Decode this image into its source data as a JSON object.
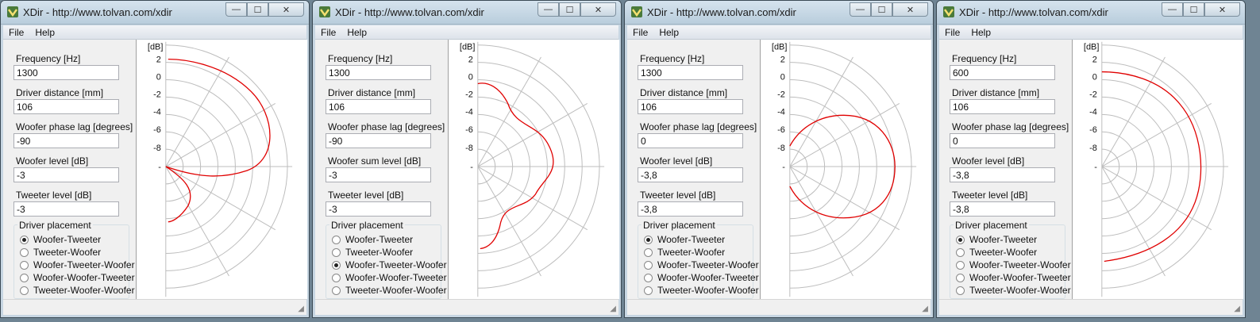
{
  "windows": [
    {
      "title": "XDir - http://www.tolvan.com/xdir",
      "menu": [
        "File",
        "Help"
      ],
      "fields": [
        {
          "label": "Frequency [Hz]",
          "value": "1300"
        },
        {
          "label": "Driver distance [mm]",
          "value": "106"
        },
        {
          "label": "Woofer phase lag [degrees]",
          "value": "-90"
        },
        {
          "label": "Woofer level [dB]",
          "value": "-3"
        },
        {
          "label": "Tweeter level [dB]",
          "value": "-3"
        }
      ],
      "placement_title": "Driver placement",
      "placements": [
        "Woofer-Tweeter",
        "Tweeter-Woofer",
        "Woofer-Tweeter-Woofer",
        "Woofer-Woofer-Tweeter",
        "Tweeter-Woofer-Woofer"
      ],
      "selected_placement": 0,
      "plot": {
        "unit": "[dB]",
        "ticks": [
          "2",
          "0",
          "-2",
          "-4",
          "-6",
          "-8",
          "-"
        ],
        "curve_color": "#e00000"
      }
    },
    {
      "title": "XDir - http://www.tolvan.com/xdir",
      "menu": [
        "File",
        "Help"
      ],
      "fields": [
        {
          "label": "Frequency [Hz]",
          "value": "1300"
        },
        {
          "label": "Driver distance [mm]",
          "value": "106"
        },
        {
          "label": "Woofer phase lag [degrees]",
          "value": "-90"
        },
        {
          "label": "Woofer sum level [dB]",
          "value": "-3"
        },
        {
          "label": "Tweeter level [dB]",
          "value": "-3"
        }
      ],
      "placement_title": "Driver placement",
      "placements": [
        "Woofer-Tweeter",
        "Tweeter-Woofer",
        "Woofer-Tweeter-Woofer",
        "Woofer-Woofer-Tweeter",
        "Tweeter-Woofer-Woofer"
      ],
      "selected_placement": 2,
      "plot": {
        "unit": "[dB]",
        "ticks": [
          "2",
          "0",
          "-2",
          "-4",
          "-6",
          "-8",
          "-"
        ],
        "curve_color": "#e00000"
      }
    },
    {
      "title": "XDir - http://www.tolvan.com/xdir",
      "menu": [
        "File",
        "Help"
      ],
      "fields": [
        {
          "label": "Frequency [Hz]",
          "value": "1300"
        },
        {
          "label": "Driver distance [mm]",
          "value": "106"
        },
        {
          "label": "Woofer phase lag [degrees]",
          "value": "0"
        },
        {
          "label": "Woofer level [dB]",
          "value": "-3,8"
        },
        {
          "label": "Tweeter level [dB]",
          "value": "-3,8"
        }
      ],
      "placement_title": "Driver placement",
      "placements": [
        "Woofer-Tweeter",
        "Tweeter-Woofer",
        "Woofer-Tweeter-Woofer",
        "Woofer-Woofer-Tweeter",
        "Tweeter-Woofer-Woofer"
      ],
      "selected_placement": 0,
      "plot": {
        "unit": "[dB]",
        "ticks": [
          "2",
          "0",
          "-2",
          "-4",
          "-6",
          "-8",
          "-"
        ],
        "curve_color": "#e00000"
      }
    },
    {
      "title": "XDir - http://www.tolvan.com/xdir",
      "menu": [
        "File",
        "Help"
      ],
      "fields": [
        {
          "label": "Frequency [Hz]",
          "value": "600"
        },
        {
          "label": "Driver distance [mm]",
          "value": "106"
        },
        {
          "label": "Woofer phase lag [degrees]",
          "value": "0"
        },
        {
          "label": "Woofer level [dB]",
          "value": "-3,8"
        },
        {
          "label": "Tweeter level [dB]",
          "value": "-3,8"
        }
      ],
      "placement_title": "Driver placement",
      "placements": [
        "Woofer-Tweeter",
        "Tweeter-Woofer",
        "Woofer-Tweeter-Woofer",
        "Woofer-Woofer-Tweeter",
        "Tweeter-Woofer-Woofer"
      ],
      "selected_placement": 0,
      "plot": {
        "unit": "[dB]",
        "ticks": [
          "2",
          "0",
          "-2",
          "-4",
          "-6",
          "-8",
          "-"
        ],
        "curve_color": "#e00000"
      }
    }
  ],
  "window_controls": {
    "minimize": "—",
    "maximize": "☐",
    "close": "✕"
  }
}
